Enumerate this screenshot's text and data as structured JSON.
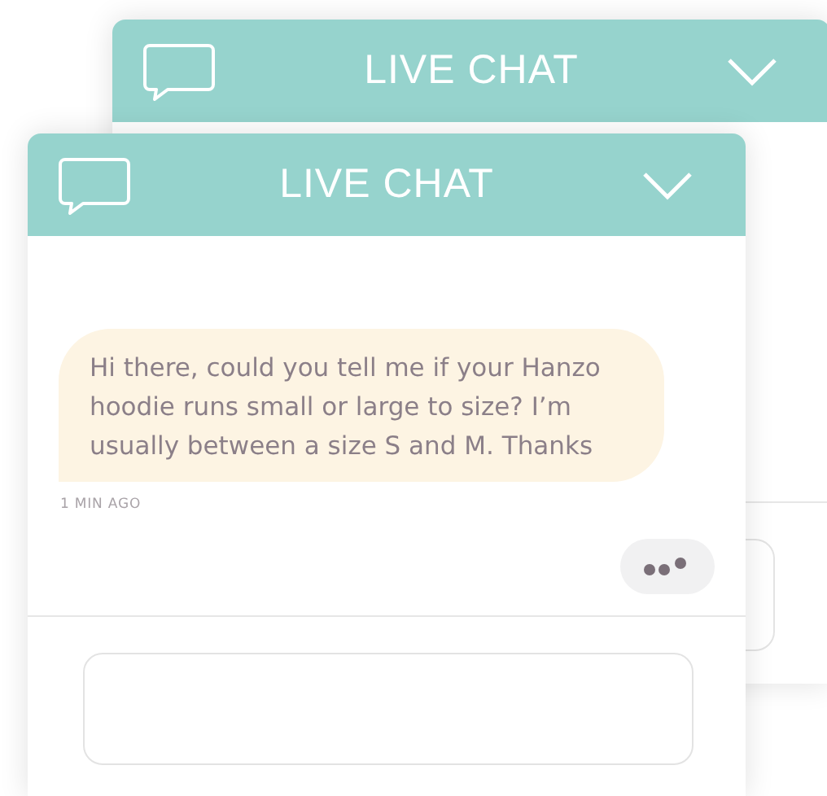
{
  "windows": [
    {
      "title": "LIVE CHAT",
      "expanded": true
    },
    {
      "title": "LIVE CHAT",
      "expanded": true,
      "messages": [
        {
          "text": "Hi there, could you tell me if your Hanzo hoodie runs small or large to size? I’m usually between a size S and M. Thanks",
          "time": "1 MIN AGO"
        }
      ],
      "typing": true
    }
  ]
}
